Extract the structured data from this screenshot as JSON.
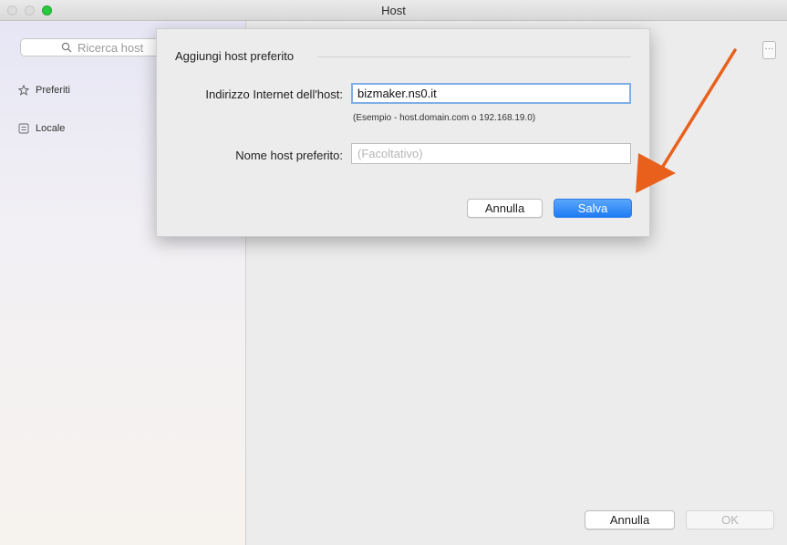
{
  "window": {
    "title": "Host"
  },
  "sidebar": {
    "search_placeholder": "Ricerca host",
    "items": [
      {
        "label": "Preferiti",
        "icon": "star-icon"
      },
      {
        "label": "Locale",
        "icon": "list-icon"
      }
    ]
  },
  "main": {
    "cancel_label": "Annulla",
    "ok_label": "OK"
  },
  "dialog": {
    "title": "Aggiungi host preferito",
    "address_label": "Indirizzo Internet dell'host:",
    "address_value": "bizmaker.ns0.it",
    "address_hint": "(Esempio - host.domain.com o 192.168.19.0)",
    "name_label": "Nome host preferito:",
    "name_placeholder": "(Facoltativo)",
    "cancel_label": "Annulla",
    "save_label": "Salva"
  },
  "colors": {
    "accent": "#1f7cf4",
    "annotation_arrow": "#e8601c",
    "maximize_button": "#27c93f"
  }
}
